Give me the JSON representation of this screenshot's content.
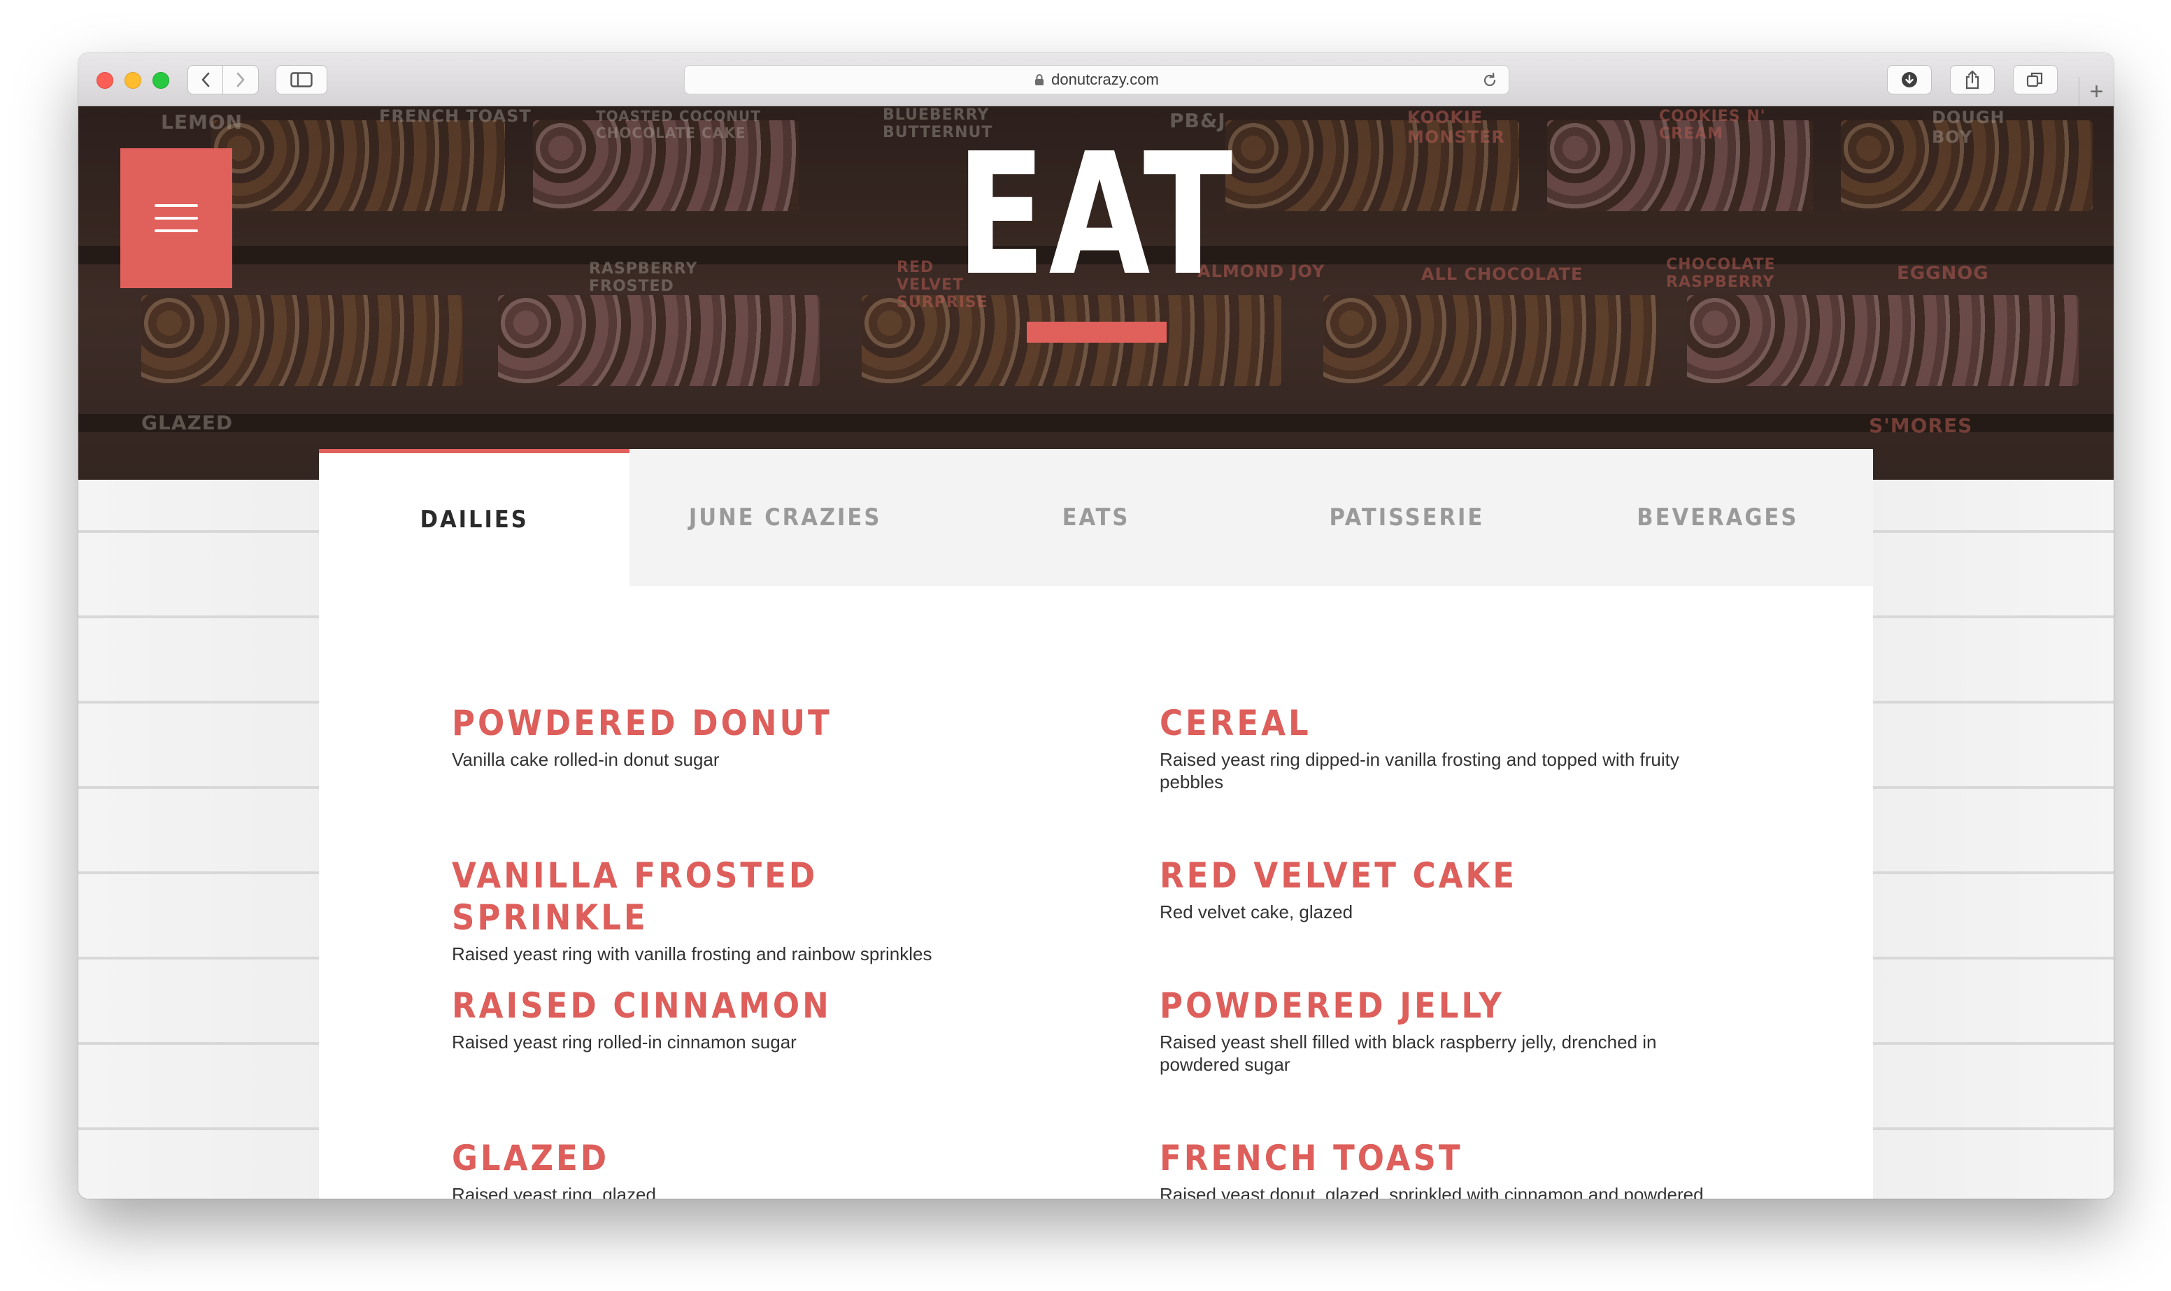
{
  "browser": {
    "url": "donutcrazy.com"
  },
  "hero": {
    "title": "EAT",
    "signs": [
      "LEMON",
      "FRENCH TOAST",
      "TOASTED COCONUT CHOCOLATE CAKE",
      "BLUEBERRY BUTTERNUT",
      "PB&J",
      "KOOKIE MONSTER",
      "COOKIES N' CREAM",
      "DOUGH BOY",
      "RASPBERRY FROSTED",
      "RED VELVET SURPRISE",
      "ALMOND JOY",
      "ALL CHOCOLATE",
      "CHOCOLATE RASPBERRY",
      "EGGNOG",
      "GLAZED",
      "S'MORES"
    ]
  },
  "tabs": [
    {
      "label": "DAILIES",
      "active": true
    },
    {
      "label": "JUNE CRAZIES",
      "active": false
    },
    {
      "label": "EATS",
      "active": false
    },
    {
      "label": "PATISSERIE",
      "active": false
    },
    {
      "label": "BEVERAGES",
      "active": false
    }
  ],
  "menu_items": [
    {
      "name": "POWDERED DONUT",
      "desc": "Vanilla cake rolled-in donut sugar"
    },
    {
      "name": "CEREAL",
      "desc": "Raised yeast ring dipped-in vanilla frosting and topped with fruity pebbles"
    },
    {
      "name": "VANILLA FROSTED SPRINKLE",
      "desc": "Raised yeast ring with vanilla frosting and rainbow sprinkles"
    },
    {
      "name": "RED VELVET CAKE",
      "desc": "Red velvet cake, glazed"
    },
    {
      "name": "RAISED CINNAMON",
      "desc": "Raised yeast ring rolled-in cinnamon sugar"
    },
    {
      "name": "POWDERED JELLY",
      "desc": "Raised yeast shell filled with black raspberry jelly, drenched in powdered sugar"
    },
    {
      "name": "GLAZED",
      "desc": "Raised yeast ring, glazed"
    },
    {
      "name": "FRENCH TOAST",
      "desc": "Raised yeast donut, glazed, sprinkled with cinnamon and powdered sugar, and drizzled with vanilla and maple icing"
    }
  ],
  "colors": {
    "accent": "#e0605c",
    "item_title": "#dd5e5a",
    "tab_inactive": "#9a9a9a",
    "tab_active": "#2b2b2b"
  }
}
